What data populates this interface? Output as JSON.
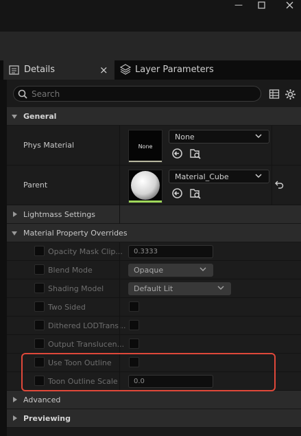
{
  "window": {
    "minimize_glyph": "—",
    "maximize_glyph": "☐",
    "close_glyph": "✕"
  },
  "tabs": [
    {
      "label": "Details",
      "close": "×",
      "icon": "details-icon"
    },
    {
      "label": "Layer Parameters",
      "icon": "layers-icon"
    }
  ],
  "search": {
    "placeholder": "Search"
  },
  "general": {
    "title": "General",
    "phys_material": {
      "label": "Phys Material",
      "thumbnail_text": "None",
      "value": "None"
    },
    "parent": {
      "label": "Parent",
      "value": "Material_Cube"
    }
  },
  "sections": {
    "lightmass": "Lightmass Settings",
    "overrides": "Material Property Overrides",
    "advanced": "Advanced",
    "previewing": "Previewing"
  },
  "overrides": {
    "opacity_mask_clip": {
      "label": "Opacity Mask Clip...",
      "value": "0.3333"
    },
    "blend_mode": {
      "label": "Blend Mode",
      "value": "Opaque"
    },
    "shading_model": {
      "label": "Shading Model",
      "value": "Default Lit"
    },
    "two_sided": {
      "label": "Two Sided"
    },
    "dithered_lod": {
      "label": "Dithered LODTrans..."
    },
    "output_translucent": {
      "label": "Output Translucen..."
    },
    "use_toon_outline": {
      "label": "Use Toon Outline"
    },
    "toon_outline_scale": {
      "label": "Toon Outline Scale",
      "value": "0.0"
    }
  },
  "colors": {
    "highlight": "#e0483a",
    "thumbnail_accent": "#9fd85a"
  }
}
